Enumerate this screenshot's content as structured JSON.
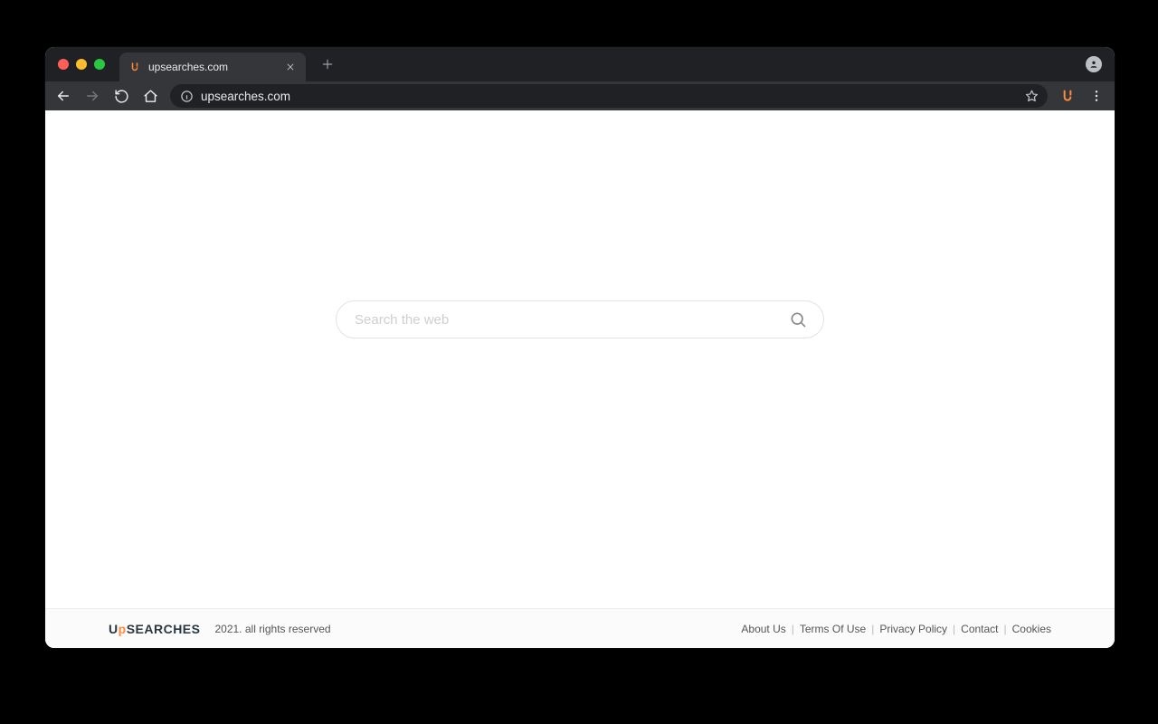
{
  "browser": {
    "tab_title": "upsearches.com",
    "url": "upsearches.com"
  },
  "page": {
    "search_placeholder": "Search the web"
  },
  "footer": {
    "brand_left": "U",
    "brand_accent": "p",
    "brand_right": "SEARCHES",
    "copyright": "2021. all rights reserved",
    "links": {
      "about": "About Us",
      "terms": "Terms Of Use",
      "privacy": "Privacy Policy",
      "contact": "Contact",
      "cookies": "Cookies"
    }
  }
}
